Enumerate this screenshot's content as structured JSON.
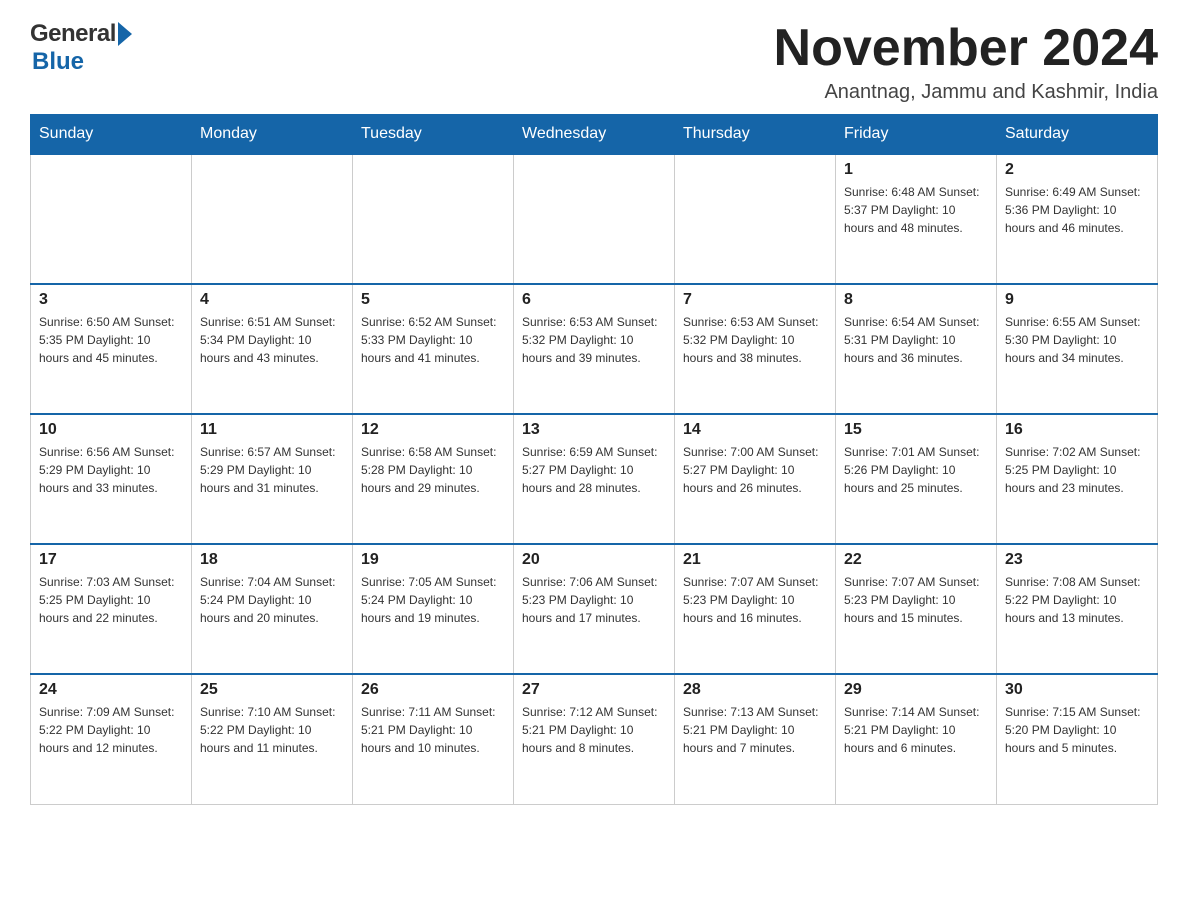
{
  "header": {
    "logo": {
      "general": "General",
      "blue": "Blue"
    },
    "title": "November 2024",
    "location": "Anantnag, Jammu and Kashmir, India"
  },
  "calendar": {
    "days_of_week": [
      "Sunday",
      "Monday",
      "Tuesday",
      "Wednesday",
      "Thursday",
      "Friday",
      "Saturday"
    ],
    "weeks": [
      [
        {
          "day": "",
          "info": ""
        },
        {
          "day": "",
          "info": ""
        },
        {
          "day": "",
          "info": ""
        },
        {
          "day": "",
          "info": ""
        },
        {
          "day": "",
          "info": ""
        },
        {
          "day": "1",
          "info": "Sunrise: 6:48 AM\nSunset: 5:37 PM\nDaylight: 10 hours and 48 minutes."
        },
        {
          "day": "2",
          "info": "Sunrise: 6:49 AM\nSunset: 5:36 PM\nDaylight: 10 hours and 46 minutes."
        }
      ],
      [
        {
          "day": "3",
          "info": "Sunrise: 6:50 AM\nSunset: 5:35 PM\nDaylight: 10 hours and 45 minutes."
        },
        {
          "day": "4",
          "info": "Sunrise: 6:51 AM\nSunset: 5:34 PM\nDaylight: 10 hours and 43 minutes."
        },
        {
          "day": "5",
          "info": "Sunrise: 6:52 AM\nSunset: 5:33 PM\nDaylight: 10 hours and 41 minutes."
        },
        {
          "day": "6",
          "info": "Sunrise: 6:53 AM\nSunset: 5:32 PM\nDaylight: 10 hours and 39 minutes."
        },
        {
          "day": "7",
          "info": "Sunrise: 6:53 AM\nSunset: 5:32 PM\nDaylight: 10 hours and 38 minutes."
        },
        {
          "day": "8",
          "info": "Sunrise: 6:54 AM\nSunset: 5:31 PM\nDaylight: 10 hours and 36 minutes."
        },
        {
          "day": "9",
          "info": "Sunrise: 6:55 AM\nSunset: 5:30 PM\nDaylight: 10 hours and 34 minutes."
        }
      ],
      [
        {
          "day": "10",
          "info": "Sunrise: 6:56 AM\nSunset: 5:29 PM\nDaylight: 10 hours and 33 minutes."
        },
        {
          "day": "11",
          "info": "Sunrise: 6:57 AM\nSunset: 5:29 PM\nDaylight: 10 hours and 31 minutes."
        },
        {
          "day": "12",
          "info": "Sunrise: 6:58 AM\nSunset: 5:28 PM\nDaylight: 10 hours and 29 minutes."
        },
        {
          "day": "13",
          "info": "Sunrise: 6:59 AM\nSunset: 5:27 PM\nDaylight: 10 hours and 28 minutes."
        },
        {
          "day": "14",
          "info": "Sunrise: 7:00 AM\nSunset: 5:27 PM\nDaylight: 10 hours and 26 minutes."
        },
        {
          "day": "15",
          "info": "Sunrise: 7:01 AM\nSunset: 5:26 PM\nDaylight: 10 hours and 25 minutes."
        },
        {
          "day": "16",
          "info": "Sunrise: 7:02 AM\nSunset: 5:25 PM\nDaylight: 10 hours and 23 minutes."
        }
      ],
      [
        {
          "day": "17",
          "info": "Sunrise: 7:03 AM\nSunset: 5:25 PM\nDaylight: 10 hours and 22 minutes."
        },
        {
          "day": "18",
          "info": "Sunrise: 7:04 AM\nSunset: 5:24 PM\nDaylight: 10 hours and 20 minutes."
        },
        {
          "day": "19",
          "info": "Sunrise: 7:05 AM\nSunset: 5:24 PM\nDaylight: 10 hours and 19 minutes."
        },
        {
          "day": "20",
          "info": "Sunrise: 7:06 AM\nSunset: 5:23 PM\nDaylight: 10 hours and 17 minutes."
        },
        {
          "day": "21",
          "info": "Sunrise: 7:07 AM\nSunset: 5:23 PM\nDaylight: 10 hours and 16 minutes."
        },
        {
          "day": "22",
          "info": "Sunrise: 7:07 AM\nSunset: 5:23 PM\nDaylight: 10 hours and 15 minutes."
        },
        {
          "day": "23",
          "info": "Sunrise: 7:08 AM\nSunset: 5:22 PM\nDaylight: 10 hours and 13 minutes."
        }
      ],
      [
        {
          "day": "24",
          "info": "Sunrise: 7:09 AM\nSunset: 5:22 PM\nDaylight: 10 hours and 12 minutes."
        },
        {
          "day": "25",
          "info": "Sunrise: 7:10 AM\nSunset: 5:22 PM\nDaylight: 10 hours and 11 minutes."
        },
        {
          "day": "26",
          "info": "Sunrise: 7:11 AM\nSunset: 5:21 PM\nDaylight: 10 hours and 10 minutes."
        },
        {
          "day": "27",
          "info": "Sunrise: 7:12 AM\nSunset: 5:21 PM\nDaylight: 10 hours and 8 minutes."
        },
        {
          "day": "28",
          "info": "Sunrise: 7:13 AM\nSunset: 5:21 PM\nDaylight: 10 hours and 7 minutes."
        },
        {
          "day": "29",
          "info": "Sunrise: 7:14 AM\nSunset: 5:21 PM\nDaylight: 10 hours and 6 minutes."
        },
        {
          "day": "30",
          "info": "Sunrise: 7:15 AM\nSunset: 5:20 PM\nDaylight: 10 hours and 5 minutes."
        }
      ]
    ]
  }
}
